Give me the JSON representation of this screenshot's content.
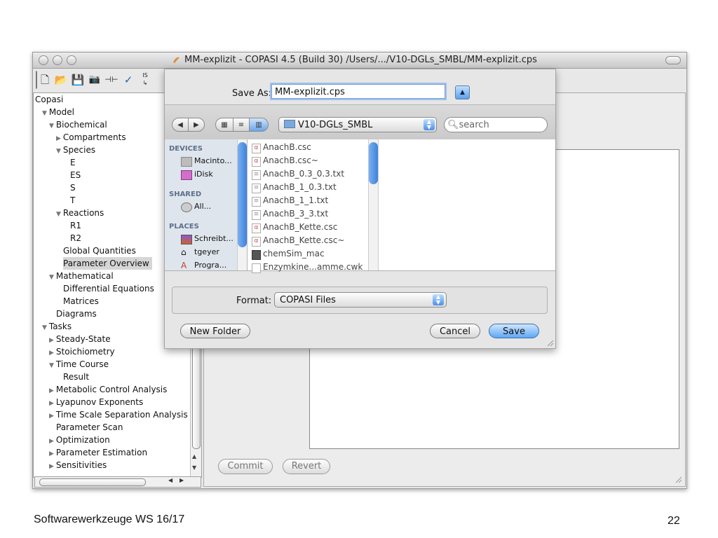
{
  "window": {
    "title": "MM-explizit - COPASI 4.5 (Build 30) /Users/.../V10-DGLs_SMBL/MM-explizit.cps"
  },
  "toolbar": {
    "icons": [
      "new-document-icon",
      "open-folder-icon",
      "save-disk-icon",
      "camera-icon",
      "reaction-arrow-icon",
      "checkmark-icon",
      "sbml-import-icon"
    ]
  },
  "tree": {
    "items": [
      {
        "label": "Copasi",
        "indent": 0,
        "toggle": ""
      },
      {
        "label": "Model",
        "indent": 1,
        "toggle": "open"
      },
      {
        "label": "Biochemical",
        "indent": 2,
        "toggle": "open"
      },
      {
        "label": "Compartments",
        "indent": 3,
        "toggle": "closed"
      },
      {
        "label": "Species",
        "indent": 3,
        "toggle": "open"
      },
      {
        "label": "E",
        "indent": 4,
        "toggle": ""
      },
      {
        "label": "ES",
        "indent": 4,
        "toggle": ""
      },
      {
        "label": "S",
        "indent": 4,
        "toggle": ""
      },
      {
        "label": "T",
        "indent": 4,
        "toggle": ""
      },
      {
        "label": "Reactions",
        "indent": 3,
        "toggle": "open"
      },
      {
        "label": "R1",
        "indent": 4,
        "toggle": ""
      },
      {
        "label": "R2",
        "indent": 4,
        "toggle": ""
      },
      {
        "label": "Global Quantities",
        "indent": 3,
        "toggle": ""
      },
      {
        "label": "Parameter Overview",
        "indent": 3,
        "toggle": "",
        "selected": true
      },
      {
        "label": "Mathematical",
        "indent": 2,
        "toggle": "open"
      },
      {
        "label": "Differential Equations",
        "indent": 3,
        "toggle": ""
      },
      {
        "label": "Matrices",
        "indent": 3,
        "toggle": ""
      },
      {
        "label": "Diagrams",
        "indent": 2,
        "toggle": ""
      },
      {
        "label": "Tasks",
        "indent": 1,
        "toggle": "open"
      },
      {
        "label": "Steady-State",
        "indent": 2,
        "toggle": "closed"
      },
      {
        "label": "Stoichiometry",
        "indent": 2,
        "toggle": "closed"
      },
      {
        "label": "Time Course",
        "indent": 2,
        "toggle": "open"
      },
      {
        "label": "Result",
        "indent": 3,
        "toggle": ""
      },
      {
        "label": "Metabolic Control Analysis",
        "indent": 2,
        "toggle": "closed"
      },
      {
        "label": "Lyapunov Exponents",
        "indent": 2,
        "toggle": "closed"
      },
      {
        "label": "Time Scale Separation Analysis",
        "indent": 2,
        "toggle": "closed"
      },
      {
        "label": "Parameter Scan",
        "indent": 2,
        "toggle": ""
      },
      {
        "label": "Optimization",
        "indent": 2,
        "toggle": "closed"
      },
      {
        "label": "Parameter Estimation",
        "indent": 2,
        "toggle": "closed"
      },
      {
        "label": "Sensitivities",
        "indent": 2,
        "toggle": "closed"
      }
    ]
  },
  "main": {
    "commit_label": "Commit",
    "revert_label": "Revert"
  },
  "save_dialog": {
    "save_as_label": "Save As:",
    "filename": "MM-explizit.cps",
    "folder": "V10-DGLs_SMBL",
    "search_placeholder": "search",
    "sidebar": {
      "devices_header": "DEVICES",
      "devices": [
        "Macinto...",
        "iDisk"
      ],
      "shared_header": "SHARED",
      "shared": [
        "All..."
      ],
      "places_header": "PLACES",
      "places": [
        "Schreibt...",
        "tgeyer",
        "Progra..."
      ]
    },
    "files": [
      {
        "name": "AnachB.csc",
        "kind": "copasi"
      },
      {
        "name": "AnachB.csc~",
        "kind": "copasi"
      },
      {
        "name": "AnachB_0.3_0.3.txt",
        "kind": "text"
      },
      {
        "name": "AnachB_1_0.3.txt",
        "kind": "text"
      },
      {
        "name": "AnachB_1_1.txt",
        "kind": "text"
      },
      {
        "name": "AnachB_3_3.txt",
        "kind": "text"
      },
      {
        "name": "AnachB_Kette.csc",
        "kind": "copasi"
      },
      {
        "name": "AnachB_Kette.csc~",
        "kind": "copasi"
      },
      {
        "name": "chemSim_mac",
        "kind": "exec"
      },
      {
        "name": "Enzymkine...amme.cwk",
        "kind": "doc"
      }
    ],
    "format_label": "Format:",
    "format_value": "COPASI Files",
    "new_folder_label": "New Folder",
    "cancel_label": "Cancel",
    "save_label": "Save",
    "accent": "#5ea7f2"
  },
  "footer": {
    "left": "Softwarewerkzeuge WS 16/17",
    "page_number": "22"
  }
}
